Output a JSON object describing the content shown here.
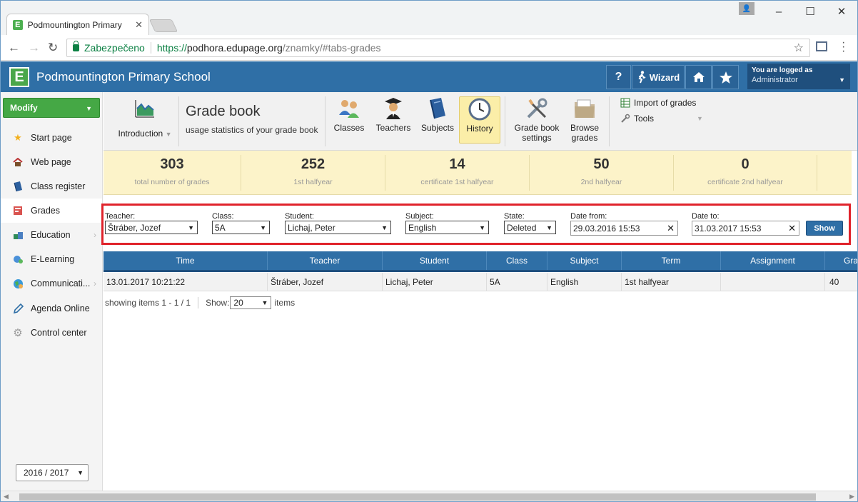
{
  "browser": {
    "tab_title": "Podmountington Primary",
    "secure_label": "Zabezpečeno",
    "url_scheme": "https://",
    "url_host": "podhora.edupage.org",
    "url_path": "/znamky/#tabs-grades"
  },
  "appbar": {
    "school_name": "Podmountington Primary School",
    "help_label": "?",
    "wizard_label": "Wizard",
    "logged_title": "You are logged as",
    "logged_user": "Administrator"
  },
  "sidebar": {
    "modify_label": "Modify",
    "items": [
      {
        "label": "Start page",
        "icon": "star-icon"
      },
      {
        "label": "Web page",
        "icon": "web-icon"
      },
      {
        "label": "Class register",
        "icon": "book-icon"
      },
      {
        "label": "Grades",
        "icon": "grades-icon"
      },
      {
        "label": "Education",
        "icon": "education-icon"
      },
      {
        "label": "E-Learning",
        "icon": "elearning-icon"
      },
      {
        "label": "Communicati...",
        "icon": "globe-icon"
      },
      {
        "label": "Agenda Online",
        "icon": "pen-icon"
      },
      {
        "label": "Control center",
        "icon": "gear-icon"
      }
    ],
    "year": "2016 / 2017"
  },
  "ribbon": {
    "intro_label": "Introduction",
    "title": "Grade book",
    "subtitle": "usage statistics of your grade book",
    "buttons": {
      "classes": "Classes",
      "teachers": "Teachers",
      "subjects": "Subjects",
      "history": "History",
      "settings_1": "Grade book",
      "settings_2": "settings",
      "browse_1": "Browse",
      "browse_2": "grades"
    },
    "import_label": "Import of grades",
    "tools_label": "Tools"
  },
  "stats": [
    {
      "value": "303",
      "label": "total number of grades"
    },
    {
      "value": "252",
      "label": "1st halfyear"
    },
    {
      "value": "14",
      "label": "certificate 1st halfyear"
    },
    {
      "value": "50",
      "label": "2nd halfyear"
    },
    {
      "value": "0",
      "label": "certificate 2nd halfyear"
    }
  ],
  "filters": {
    "teacher_label": "Teacher:",
    "teacher": "Štráber, Jozef",
    "class_label": "Class:",
    "class": "5A",
    "student_label": "Student:",
    "student": "Lichaj, Peter",
    "subject_label": "Subject:",
    "subject": "English",
    "state_label": "State:",
    "state": "Deleted",
    "from_label": "Date from:",
    "from": "29.03.2016 15:53",
    "to_label": "Date to:",
    "to": "31.03.2017 15:53",
    "show_label": "Show"
  },
  "table": {
    "columns": [
      "Time",
      "Teacher",
      "Student",
      "Class",
      "Subject",
      "Term",
      "Assignment",
      "Gra"
    ],
    "rows": [
      [
        "13.01.2017 10:21:22",
        "Štráber, Jozef",
        "Lichaj, Peter",
        "5A",
        "English",
        "1st halfyear",
        "",
        "40"
      ]
    ]
  },
  "pager": {
    "showing": "showing items 1 - 1 / 1",
    "show_label": "Show:",
    "page_size": "20",
    "items_label": "items"
  }
}
